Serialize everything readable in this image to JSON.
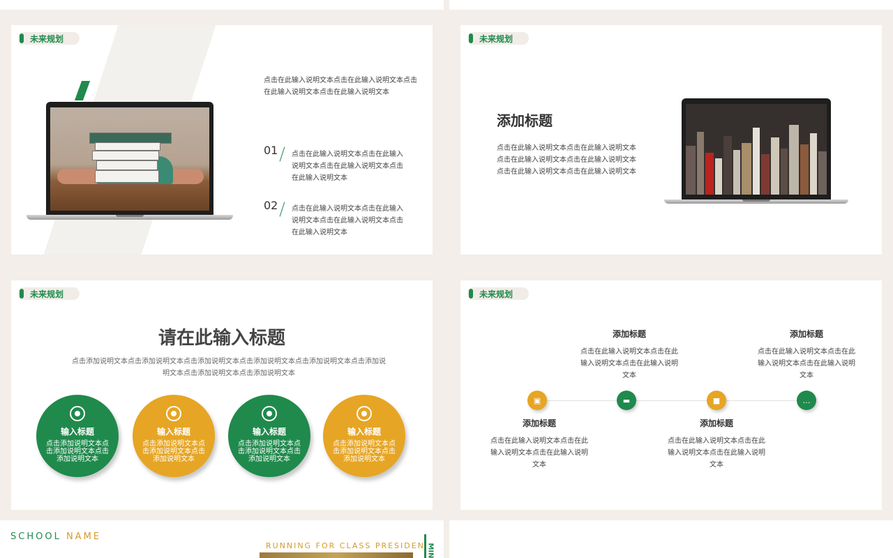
{
  "colors": {
    "green": "#1f8a4c",
    "orange": "#e6a524",
    "background": "#f3eee9"
  },
  "tag_label": "未来规划",
  "panel1": {
    "intro": "点击在此输入说明文本点击在此输入说明文本点击在此输入说明文本点击在此输入说明文本",
    "items": [
      {
        "num": "01",
        "text": "点击在此输入说明文本点击在此输入说明文本点击在此输入说明文本点击在此输入说明文本"
      },
      {
        "num": "02",
        "text": "点击在此输入说明文本点击在此输入说明文本点击在此输入说明文本点击在此输入说明文本"
      }
    ]
  },
  "panel2": {
    "title": "添加标题",
    "text": "点击在此输入说明文本点击在此输入说明文本点击在此输入说明文本点击在此输入说明文本点击在此输入说明文本点击在此输入说明文本"
  },
  "panel3": {
    "title": "请在此输入标题",
    "desc": "点击添加说明文本点击添加说明文本点击添加说明文本点击添加说明文本点击添加说明文本点击添加说明文本点击添加说明文本点击添加说明文本",
    "circles": [
      {
        "title": "输入标题",
        "text": "点击添加说明文本点击添加说明文本点击添加说明文本",
        "color": "green",
        "icon": "target-icon"
      },
      {
        "title": "输入标题",
        "text": "点击添加说明文本点击添加说明文本点击添加说明文本",
        "color": "orange",
        "icon": "target-icon"
      },
      {
        "title": "输入标题",
        "text": "点击添加说明文本点击添加说明文本点击添加说明文本",
        "color": "green",
        "icon": "target-icon"
      },
      {
        "title": "输入标题",
        "text": "点击添加说明文本点击添加说明文本点击添加说明文本",
        "color": "orange",
        "icon": "target-icon"
      }
    ]
  },
  "panel4": {
    "steps": [
      {
        "title": "添加标题",
        "text": "点击在此输入说明文本点击在此输入说明文本点击在此输入说明文本",
        "icon": "image-icon",
        "color": "orange"
      },
      {
        "title": "添加标题",
        "text": "点击在此输入说明文本点击在此输入说明文本点击在此输入说明文本",
        "icon": "sofa-icon",
        "color": "green"
      },
      {
        "title": "添加标题",
        "text": "点击在此输入说明文本点击在此输入说明文本点击在此输入说明文本",
        "icon": "briefcase-icon",
        "color": "orange"
      },
      {
        "title": "添加标题",
        "text": "点击在此输入说明文本点击在此输入说明文本点击在此输入说明文本",
        "icon": "chat-icon",
        "color": "green"
      }
    ]
  },
  "panel5": {
    "school": "SCHOOL",
    "name": "NAME",
    "running": "RUNNING FOR CLASS PRESIDENT",
    "side": "MIN"
  }
}
